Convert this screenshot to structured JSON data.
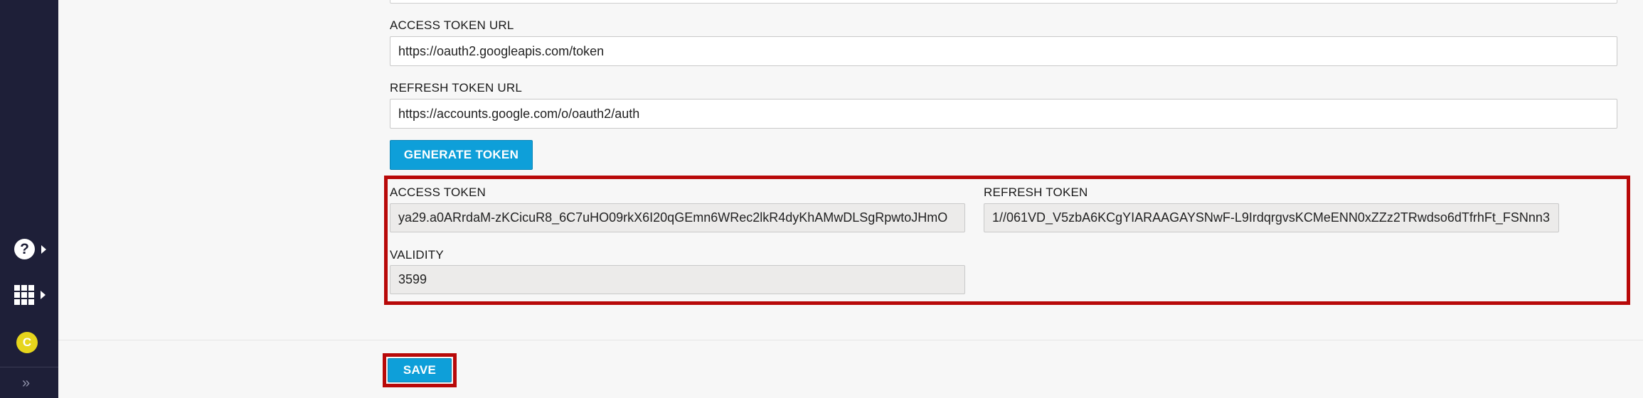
{
  "sidebar": {
    "help_glyph": "?",
    "avatar_initial": "C",
    "expand_glyph": "»",
    "icons": [
      "help-icon",
      "apps-grid-icon",
      "caret-right-icon",
      "avatar",
      "double-chevron-right-icon"
    ]
  },
  "form": {
    "access_token_url": {
      "label": "ACCESS TOKEN URL",
      "value": "https://oauth2.googleapis.com/token"
    },
    "refresh_token_url": {
      "label": "REFRESH TOKEN URL",
      "value": "https://accounts.google.com/o/oauth2/auth"
    },
    "generate_button": "GENERATE TOKEN",
    "access_token": {
      "label": "ACCESS TOKEN",
      "value": "ya29.a0ARrdaM-zKCicuR8_6C7uHO09rkX6I20qGEmn6WRec2lkR4dyKhAMwDLSgRpwtoJHmO"
    },
    "refresh_token": {
      "label": "REFRESH TOKEN",
      "value": "1//061VD_V5zbA6KCgYIARAAGAYSNwF-L9IrdqrgvsKCMeENN0xZZz2TRwdso6dTfrhFt_FSNnn3"
    },
    "validity": {
      "label": "VALIDITY",
      "value": "3599"
    },
    "save_button": "SAVE"
  },
  "colors": {
    "sidebar_bg": "#1e1f38",
    "primary_button": "#0e9fd9",
    "highlight_border": "#b80909",
    "avatar": "#e6d51c"
  }
}
